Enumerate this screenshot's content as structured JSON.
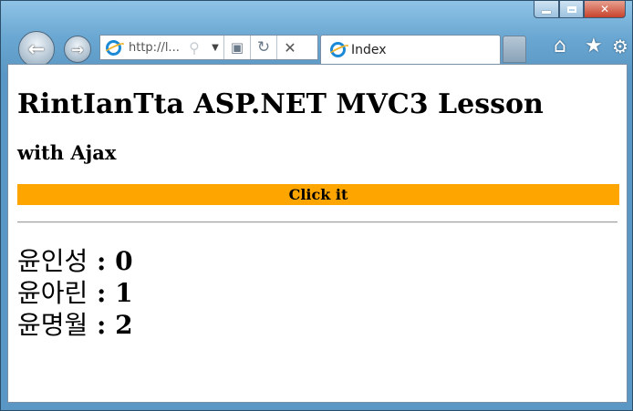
{
  "browser": {
    "address_url": "http://l...",
    "tab_title": "Index",
    "icons": [
      "back-icon",
      "forward-icon",
      "ie-logo-icon",
      "search-icon",
      "dropdown-icon",
      "compat-view-icon",
      "refresh-icon",
      "stop-icon",
      "home-icon",
      "favorites-star-icon",
      "tools-gear-icon"
    ]
  },
  "page": {
    "heading": "RintIanTta ASP.NET MVC3 Lesson",
    "subheading": "with Ajax",
    "button_label": "Click it",
    "button_color": "#ffa500",
    "items": [
      {
        "name": "윤인성",
        "sep": " : ",
        "value": "0"
      },
      {
        "name": "윤아린",
        "sep": " : ",
        "value": "1"
      },
      {
        "name": "윤명월",
        "sep": " : ",
        "value": "2"
      }
    ]
  }
}
